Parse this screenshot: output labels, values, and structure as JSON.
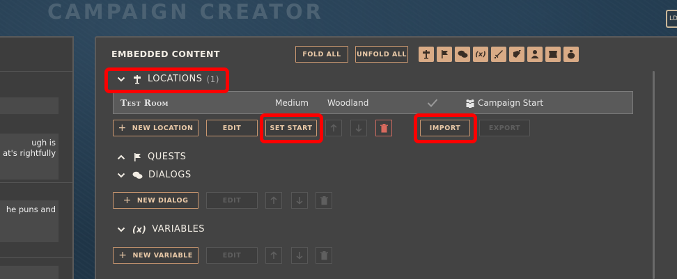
{
  "app": {
    "title": "CAMPAIGN CREATOR",
    "corner_label": "LD"
  },
  "left_panel": {
    "snippets": [
      [
        "ugh is",
        "at's rightfully"
      ],
      [
        "he puns and"
      ]
    ]
  },
  "embedded": {
    "heading": "EMBEDDED CONTENT",
    "fold_all": "FOLD ALL",
    "unfold_all": "UNFOLD ALL",
    "toolbar_icons": [
      "signpost-icon",
      "quest-flag-icon",
      "dialog-bubbles-icon",
      "variable-x-icon",
      "sword-icon",
      "scroll-quill-icon",
      "person-icon",
      "map-icon",
      "bag-icon"
    ]
  },
  "locations": {
    "label": "LOCATIONS",
    "count": "(1)",
    "rows": [
      {
        "name": "Test Room",
        "size": "Medium",
        "biome": "Woodland",
        "start_label": "Campaign Start"
      }
    ],
    "buttons": {
      "new": "NEW LOCATION",
      "edit": "EDIT",
      "set_start": "SET START",
      "import": "IMPORT",
      "export": "EXPORT"
    }
  },
  "quests": {
    "label": "QUESTS"
  },
  "dialogs": {
    "label": "DIALOGS",
    "buttons": {
      "new": "NEW DIALOG",
      "edit": "EDIT"
    }
  },
  "variables": {
    "label": "VARIABLES",
    "prefix": "(x)",
    "buttons": {
      "new": "NEW VARIABLE",
      "edit": "EDIT"
    }
  },
  "colors": {
    "accent": "#d9ab86",
    "button_border": "#c99770",
    "highlight": "#ff0000"
  }
}
